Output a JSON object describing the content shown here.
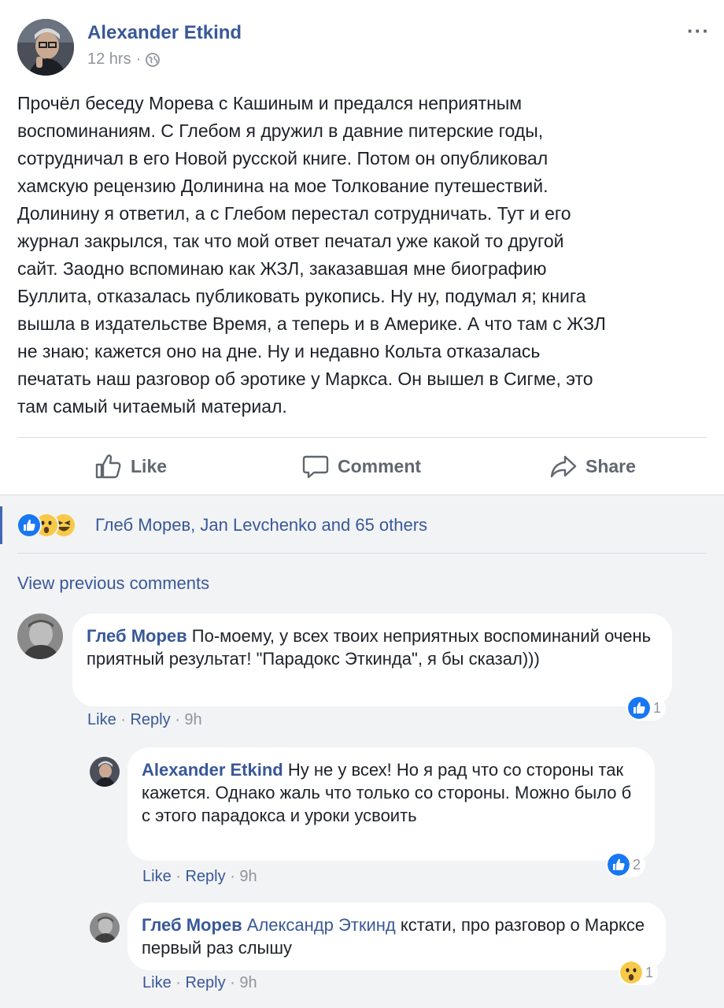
{
  "post": {
    "author": "Alexander Etkind",
    "time": "12 hrs",
    "separator": "·",
    "more_label": "···",
    "text": "Прочёл беседу Морева с Кашиным и предался неприятным\nвоспоминаниям. С Глебом я дружил в давние питерские годы,\nсотрудничал в его Новой русской книге. Потом он опубликовал\nхамскую рецензию Долинина на мое Толкование путешествий.\nДолинину я ответил, а с Глебом перестал сотрудничать. Тут и его\nжурнал закрылся, так что мой ответ печатал уже какой то другой\nсайт. Заодно вспоминаю как ЖЗЛ, заказавшая мне биографию\nБуллита, отказалась публиковать рукопись. Ну ну, подумал я; книга\nвышла в издательстве Время, а теперь и в Америке. А что там с ЖЗЛ\nне знаю; кажется оно на дне. Ну и недавно Кольта отказалась\nпечатать наш разговор об эротике у Маркса. Он вышел в Сигме, это\nтам самый читаемый материал."
  },
  "actions": {
    "like": "Like",
    "comment": "Comment",
    "share": "Share"
  },
  "reactions": {
    "icons": [
      "like-icon",
      "wow-icon",
      "haha-icon"
    ],
    "summary": "Глеб Морев, Jan Levchenko and 65 others"
  },
  "view_previous": "View previous comments",
  "comments": [
    {
      "author": "Глеб Морев",
      "text": "По-моему, у всех твоих неприятных воспоминаний очень приятный результат! \"Парадокс Эткинда\", я бы сказал)))",
      "like": "Like",
      "reply": "Reply",
      "time": "9h",
      "reaction_icon": "like-icon",
      "reaction_count": "1"
    },
    {
      "author": "Alexander Etkind",
      "text": "Ну не у всех! Но я рад что со стороны так кажется. Однако жаль что только со стороны. Можно было б с этого парадокса и уроки усвоить",
      "like": "Like",
      "reply": "Reply",
      "time": "9h",
      "reaction_icon": "like-icon",
      "reaction_count": "2"
    },
    {
      "author": "Глеб Морев",
      "mention": "Александр Эткинд",
      "text": "кстати, про разговор о Марксе первый раз слышу",
      "like": "Like",
      "reply": "Reply",
      "time": "9h",
      "reaction_icon": "wow-icon",
      "reaction_count": "1"
    }
  ],
  "colors": {
    "link": "#385898",
    "like_blue": "#1877f2",
    "meta_gray": "#90949c",
    "comments_bg": "#f2f3f5",
    "reaction_yellow": "#f7c947"
  }
}
